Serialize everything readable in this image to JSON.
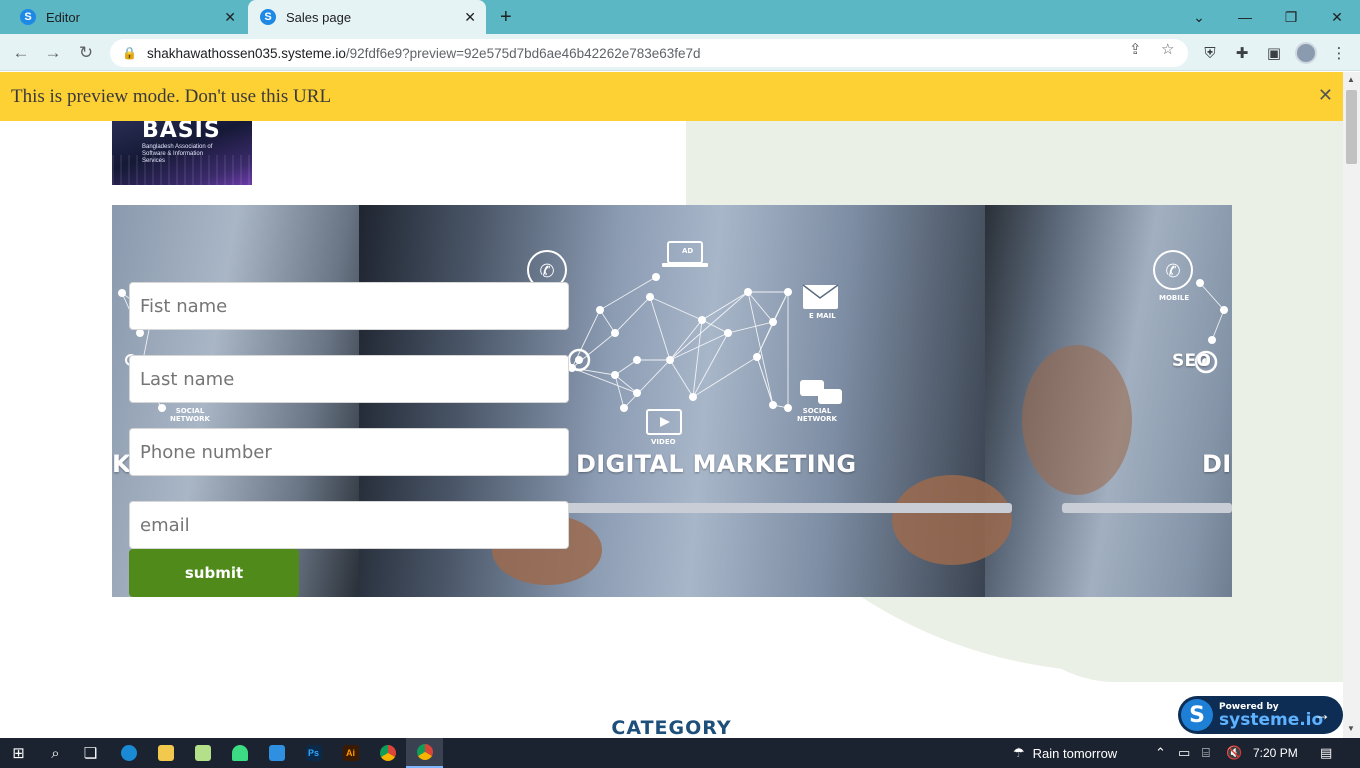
{
  "browser": {
    "tabs": [
      {
        "title": "Editor",
        "favicon": "S"
      },
      {
        "title": "Sales page",
        "favicon": "S"
      }
    ],
    "url_host": "shakhawathossen035.systeme.io",
    "url_path": "/92fdf6e9?preview=92e575d7bd6ae46b42262e783e63fe7d"
  },
  "page": {
    "preview_banner": "This is preview mode. Don't use this URL",
    "logo": {
      "word": "BASIS",
      "subtitle": "Bangladesh Association of Software & Information Services"
    },
    "hero": {
      "headline": "DIGITAL MARKETING",
      "left_fragment": "K",
      "right_fragment": "DI",
      "icon_labels": {
        "ad": "AD",
        "email": "E MAIL",
        "social": "SOCIAL NETWORK",
        "video": "VIDEO",
        "mobile": "MOBILE",
        "seo": "SEO"
      }
    },
    "form": {
      "first_name_placeholder": "Fist name",
      "last_name_placeholder": "Last name",
      "phone_placeholder": "Phone number",
      "email_placeholder": "email",
      "submit_label": "submit"
    },
    "category_heading": "CATEGORY",
    "powered_badge": {
      "by": "Powered by",
      "brand": "systeme.io",
      "logo_letter": "S"
    }
  },
  "taskbar": {
    "weather": "Rain tomorrow",
    "time": "7:20 PM",
    "apps": [
      "start",
      "search",
      "task-view",
      "edge",
      "file-explorer",
      "notepad",
      "android-studio",
      "vscode",
      "photoshop",
      "illustrator",
      "chrome",
      "chrome-active"
    ],
    "app_labels": {
      "photoshop": "Ps",
      "illustrator": "Ai"
    }
  },
  "colors": {
    "tabbar": "#5bb7c4",
    "banner": "#fdd033",
    "submit": "#4f8a1b",
    "category": "#1d4f7a",
    "badge": "#0d2d54"
  }
}
